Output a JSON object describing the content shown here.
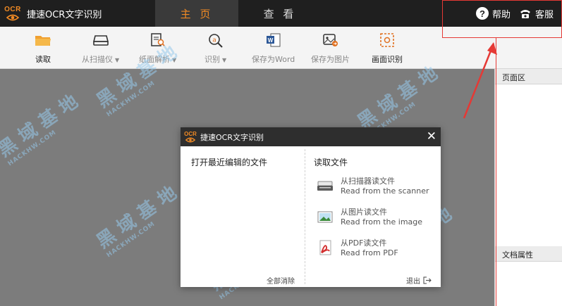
{
  "app": {
    "logo_text": "OCR",
    "title": "捷速OCR文字识别"
  },
  "tabs": [
    {
      "label": "主 页",
      "active": true
    },
    {
      "label": "查 看",
      "active": false
    }
  ],
  "header_buttons": {
    "help": "帮助",
    "service": "客服"
  },
  "toolbar": {
    "read": "读取",
    "scan": "从扫描仪",
    "paper": "纸面解析",
    "recognize": "识别",
    "save_word": "保存为Word",
    "save_image": "保存为图片",
    "screen_ocr": "画面识别"
  },
  "right_panel": {
    "page_area": "页面区",
    "doc_props": "文档属性"
  },
  "dialog": {
    "logo_text": "OCR",
    "title": "捷速OCR文字识别",
    "recent_title": "打开最近编辑的文件",
    "read_title": "读取文件",
    "items": [
      {
        "zh": "从扫描器读文件",
        "en": "Read from the scanner",
        "icon": "scanner-icon"
      },
      {
        "zh": "从图片读文件",
        "en": "Read from the image",
        "icon": "image-icon"
      },
      {
        "zh": "从PDF读文件",
        "en": "Read from PDF",
        "icon": "pdf-icon"
      }
    ],
    "clear_all": "全部消除",
    "exit": "退出"
  },
  "colors": {
    "accent": "#f08a24",
    "titlebar": "#1f1f1f",
    "annotation": "#e53935"
  }
}
